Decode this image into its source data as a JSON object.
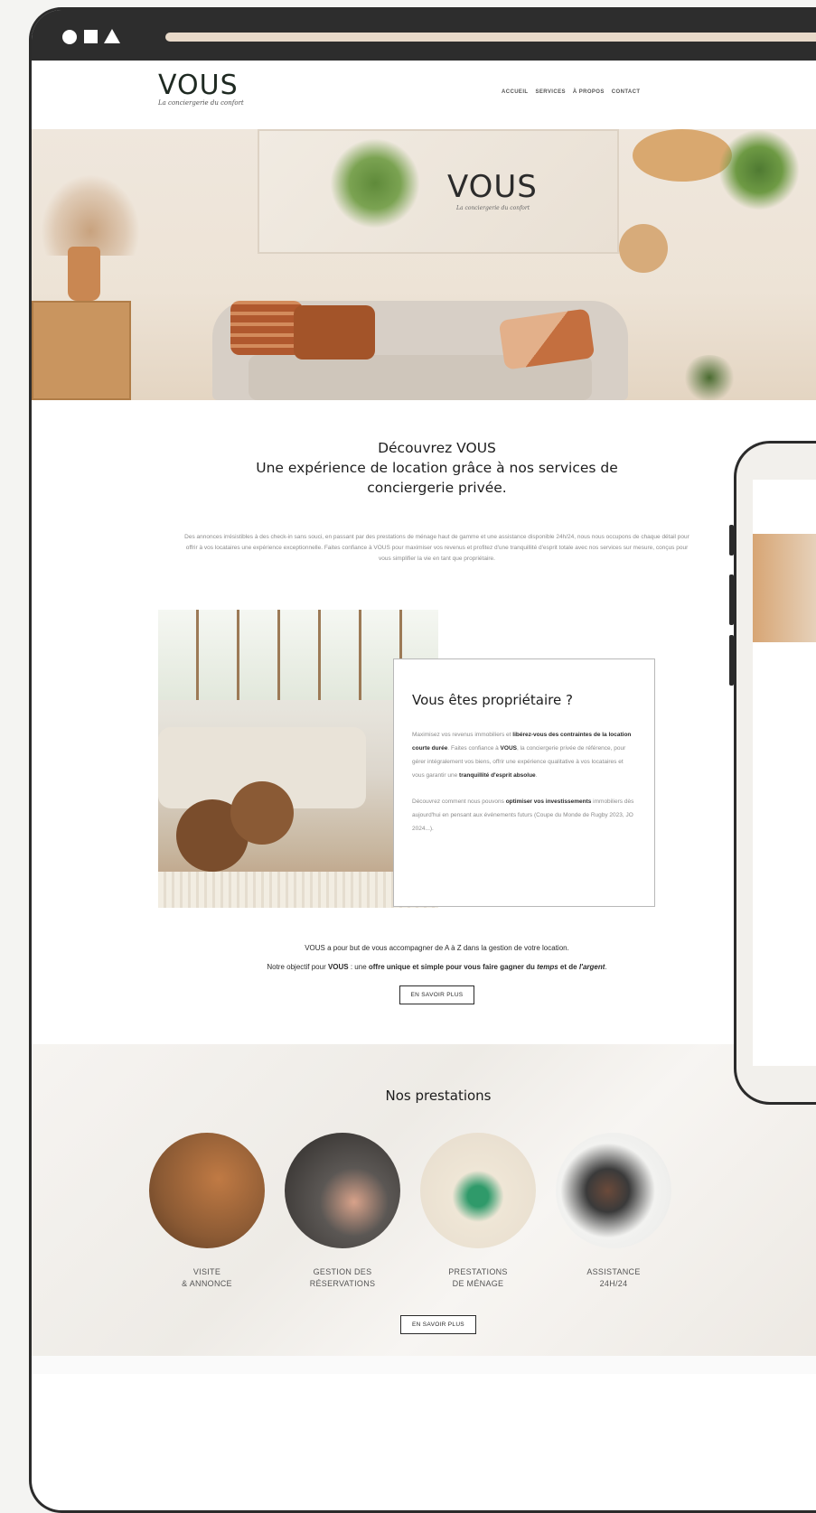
{
  "site": {
    "logo": "VOUS",
    "tagline": "La conciergerie du confort",
    "nav": [
      "ACCUEIL",
      "SERVICES",
      "À PROPOS",
      "CONTACT"
    ]
  },
  "hero": {
    "art_logo": "VOUS",
    "art_tagline": "La conciergerie du confort"
  },
  "intro": {
    "title": "Découvrez VOUS",
    "subtitle": "Une expérience de location grâce à nos services de conciergerie privée.",
    "lead": "Des annonces irrésistibles à des check-in sans souci, en passant par des prestations de ménage haut de gamme et une assistance disponible 24h/24, nous nous occupons de chaque détail pour offrir à vos locataires une expérience exceptionnelle. Faites confiance à VOUS pour maximiser vos revenus et profitez d'une tranquillité d'esprit totale avec nos services sur mesure, conçus pour vous simplifier la vie en tant que propriétaire."
  },
  "owner": {
    "title": "Vous êtes propriétaire ?",
    "p1_a": "Maximisez vos revenus immobiliers et ",
    "p1_b": "libérez-vous des contraintes de la location courte durée",
    "p1_c": ". Faites confiance à ",
    "p1_d": "VOUS",
    "p1_e": ", la conciergerie privée de référence, pour gérer intégralement vos biens, offrir une expérience qualitative à vos locataires et vous garantir une ",
    "p1_f": "tranquillité d'esprit absolue",
    "p1_g": ".",
    "p2_a": "Découvrez comment nous pouvons ",
    "p2_b": "optimiser vos investissements",
    "p2_c": " immobiliers dès aujourd'hui en pensant aux événements futurs (Coupe du Monde de Rugby 2023, JO 2024...)."
  },
  "goal": {
    "line1": "VOUS a pour but de vous accompagner de A à Z dans la gestion de votre location.",
    "line2_a": "Notre objectif pour ",
    "line2_b": "VOUS",
    "line2_c": " : une ",
    "line2_d": "offre unique et simple pour vous faire gagner du ",
    "line2_e": "temps",
    "line2_f": " et de ",
    "line2_g": "l'argent",
    "line2_h": ".",
    "button": "EN SAVOIR PLUS"
  },
  "services": {
    "title": "Nos prestations",
    "items": [
      {
        "line1": "VISITE",
        "line2": "& ANNONCE",
        "color": "#8b5a34"
      },
      {
        "line1": "GESTION DES",
        "line2": "RÉSERVATIONS",
        "color": "#2d2a28"
      },
      {
        "line1": "PRESTATIONS",
        "line2": "DE MÉNAGE",
        "color": "#e6dccd"
      },
      {
        "line1": "ASSISTANCE",
        "line2": "24H/24",
        "color": "#e9e9e7"
      }
    ],
    "button": "EN SAVOIR PLUS"
  }
}
